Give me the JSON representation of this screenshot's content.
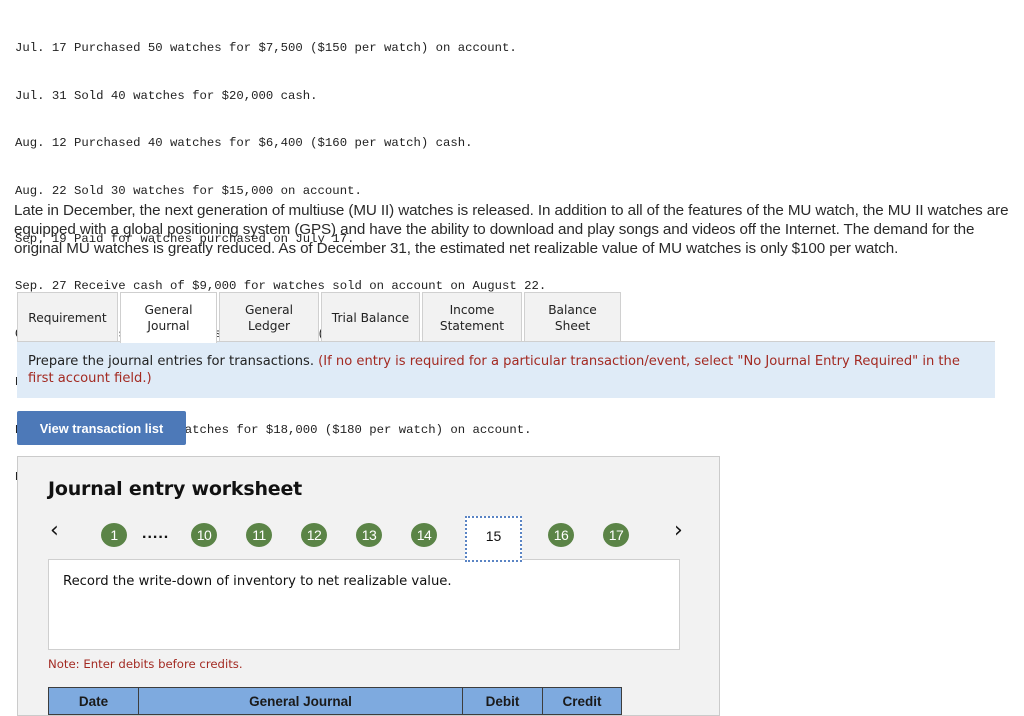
{
  "transactions": [
    "Jul. 17 Purchased 50 watches for $7,500 ($150 per watch) on account.",
    "Jul. 31 Sold 40 watches for $20,000 cash.",
    "Aug. 12 Purchased 40 watches for $6,400 ($160 per watch) cash.",
    "Aug. 22 Sold 30 watches for $15,000 on account.",
    "Sep. 19 Paid for watches purchased on July 17.",
    "Sep. 27 Receive cash of $9,000 for watches sold on account on August 22.",
    "Oct. 27 Purchased 80 watches for $13,600 ($170 per watch) cash.",
    "Nov. 20 Sold 90 watches for $45,000 cash.",
    "Dec.  4 Purchased 100 watches for $18,000 ($180 per watch) on account.",
    "Dec.  8 Sold 40 watches for $20,000 on account."
  ],
  "scenario": "Late in December, the next generation of multiuse (MU II) watches is released. In addition to all of the features of the MU watch, the MU II watches are equipped with a global positioning system (GPS) and have the ability to download and play songs and videos off the Internet. The demand for the original MU watches is greatly reduced. As of December 31, the estimated net realizable value of MU watches is only $100 per watch.",
  "tabs": [
    {
      "line1": "Requirement",
      "line2": "",
      "active": false
    },
    {
      "line1": "General",
      "line2": "Journal",
      "active": true
    },
    {
      "line1": "General",
      "line2": "Ledger",
      "active": false
    },
    {
      "line1": "Trial Balance",
      "line2": "",
      "active": false
    },
    {
      "line1": "Income",
      "line2": "Statement",
      "active": false
    },
    {
      "line1": "Balance Sheet",
      "line2": "",
      "active": false
    }
  ],
  "instruction": {
    "main": "Prepare the journal entries for transactions. ",
    "note": "(If no entry is required for a particular transaction/event, select \"No Journal Entry Required\" in the first account field.)"
  },
  "view_transaction_button": "View transaction list",
  "worksheet": {
    "title": "Journal entry worksheet",
    "prev_icon": "‹",
    "next_icon": "›",
    "ellipsis": ".....",
    "steps": [
      "1",
      "10",
      "11",
      "12",
      "13",
      "14",
      "15",
      "16",
      "17"
    ],
    "current_step": "15",
    "step_color": "#5b8447",
    "prompt": "Record the write-down of inventory to net realizable value.",
    "note": "Note: Enter debits before credits.",
    "table_headers": {
      "date": "Date",
      "general_journal": "General Journal",
      "debit": "Debit",
      "credit": "Credit"
    }
  }
}
